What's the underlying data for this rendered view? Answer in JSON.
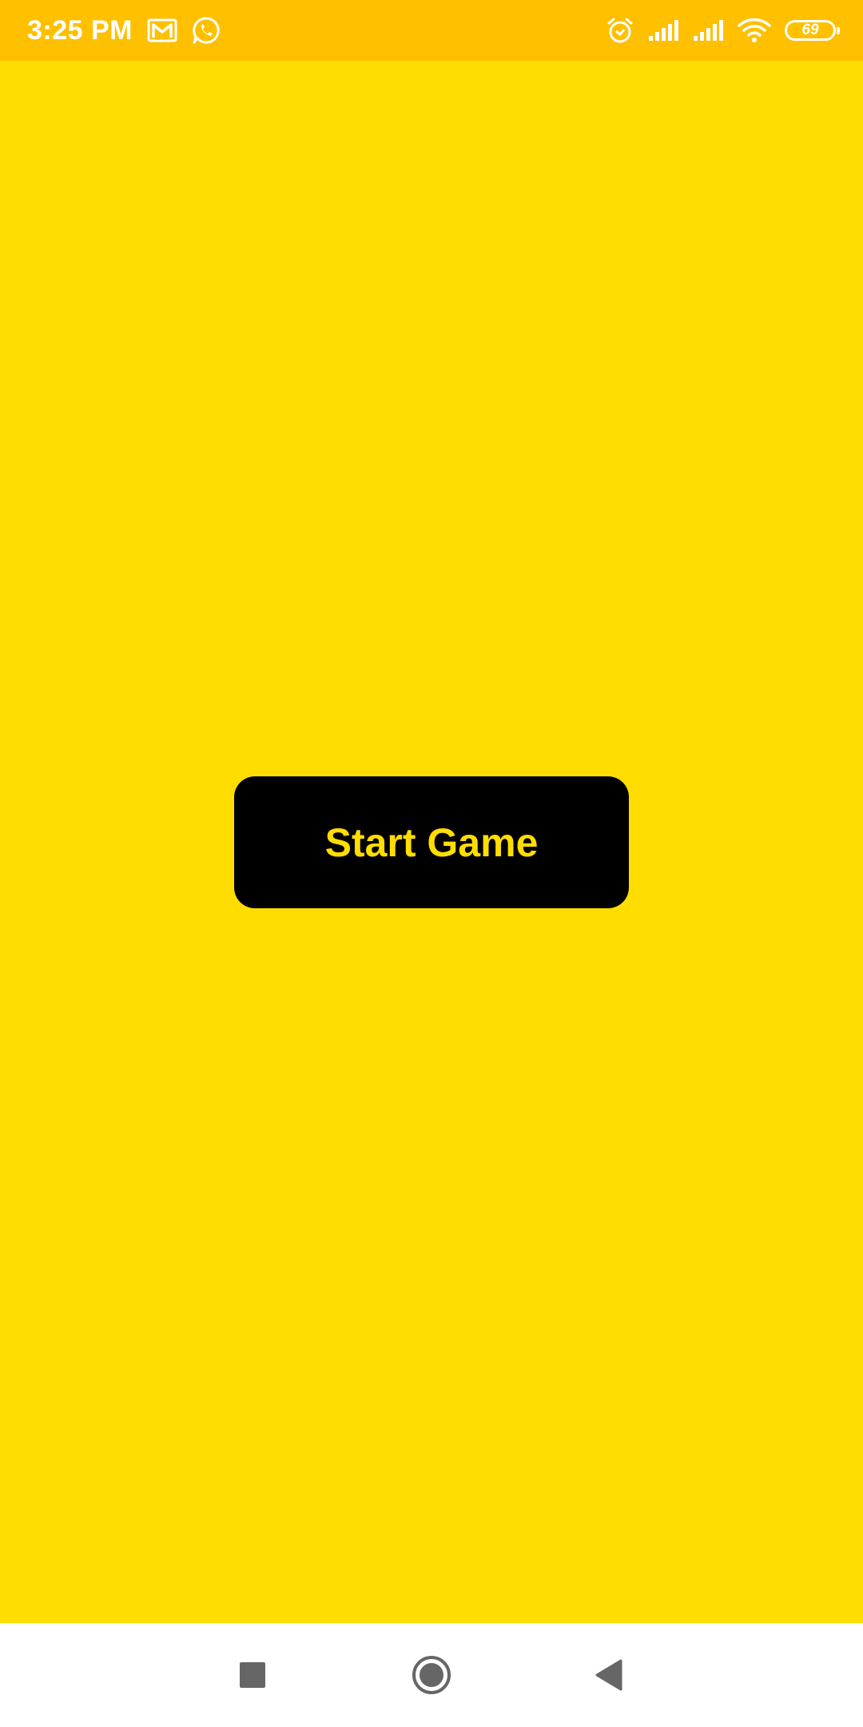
{
  "status_bar": {
    "time": "3:25 PM",
    "battery_level": "69",
    "icons": [
      "gmail-icon",
      "whatsapp-icon",
      "alarm-icon",
      "signal-icon",
      "signal-icon",
      "wifi-icon",
      "battery-icon"
    ]
  },
  "main": {
    "start_button_label": "Start Game"
  },
  "nav_bar": {
    "buttons": [
      "recents-button",
      "home-button",
      "back-button"
    ]
  },
  "colors": {
    "background": "#FFDD00",
    "status_bar": "#FFC000",
    "button_bg": "#000000",
    "button_text": "#FFDD00",
    "nav_bar": "#FFFFFF",
    "nav_icons": "#666666"
  }
}
